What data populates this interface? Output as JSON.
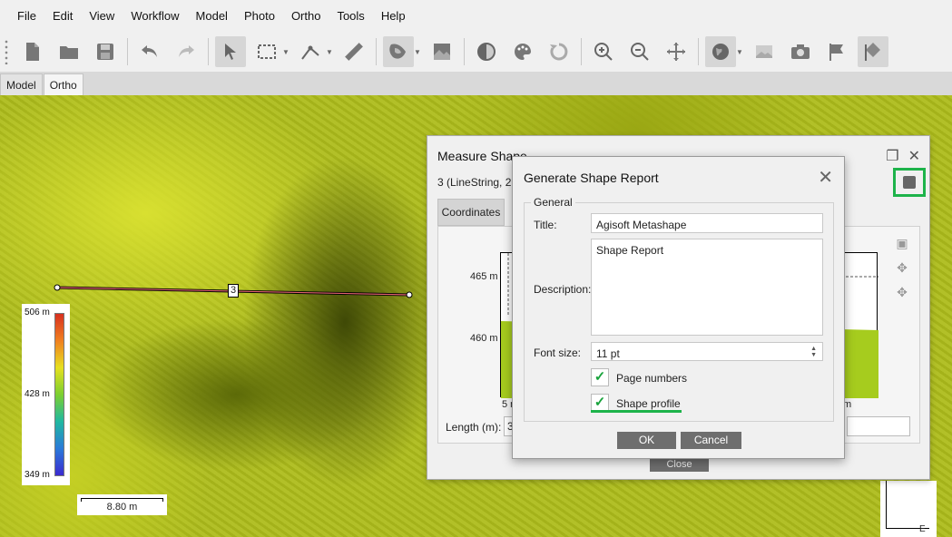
{
  "menu": [
    "File",
    "Edit",
    "View",
    "Workflow",
    "Model",
    "Photo",
    "Ortho",
    "Tools",
    "Help"
  ],
  "tabs": [
    "Model",
    "Ortho"
  ],
  "active_tab": "Ortho",
  "legend": {
    "max": "506 m",
    "mid": "428 m",
    "min": "349 m"
  },
  "scale_bar": "8.80 m",
  "compass_label": "E",
  "line_label": "3",
  "measure_dialog": {
    "title": "Measure Shape",
    "subtitle": "3 (LineString, 2 v",
    "tab": "Coordinates",
    "y_ticks": [
      "465 m",
      "460 m"
    ],
    "x_tick_left": "5 m",
    "x_tick_right": "m",
    "length_label": "Length (m):",
    "length_value": "3",
    "close_label": "Close"
  },
  "report_dialog": {
    "title": "Generate Shape Report",
    "group_label": "General",
    "title_label": "Title:",
    "title_value": "Agisoft Metashape",
    "description_label": "Description:",
    "description_value": "Shape Report",
    "font_size_label": "Font size:",
    "font_size_value": "11 pt",
    "page_numbers_label": "Page numbers",
    "shape_profile_label": "Shape profile",
    "ok_label": "OK",
    "cancel_label": "Cancel"
  },
  "colors": {
    "highlight": "#1db34a",
    "check": "#19a33c",
    "profile_fill": "#a6cc1e"
  }
}
